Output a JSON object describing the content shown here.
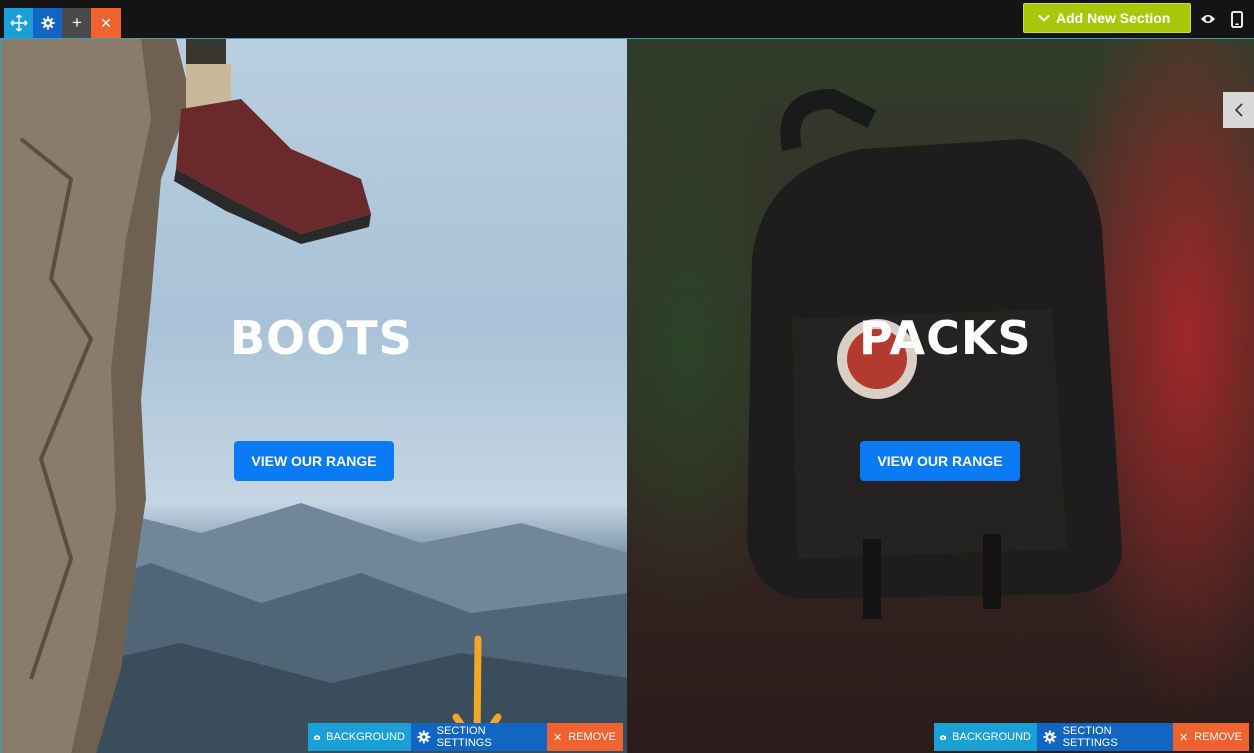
{
  "topbar": {
    "add_section_label": "Add New Section"
  },
  "panels": [
    {
      "heading": "BOOTS",
      "cta": "VIEW OUR RANGE"
    },
    {
      "heading": "PACKS",
      "cta": "VIEW OUR RANGE"
    }
  ],
  "section_toolbar": {
    "background_label": "BACKGROUND",
    "settings_label": "SECTION SETTINGS",
    "remove_label": "REMOVE"
  },
  "colors": {
    "accent_blue": "#0a7bf5",
    "add_section_green": "#a9c80a",
    "remove_orange": "#f0622e",
    "move_cyan": "#1a9fd6",
    "annotation_arrow": "#f5a623"
  }
}
